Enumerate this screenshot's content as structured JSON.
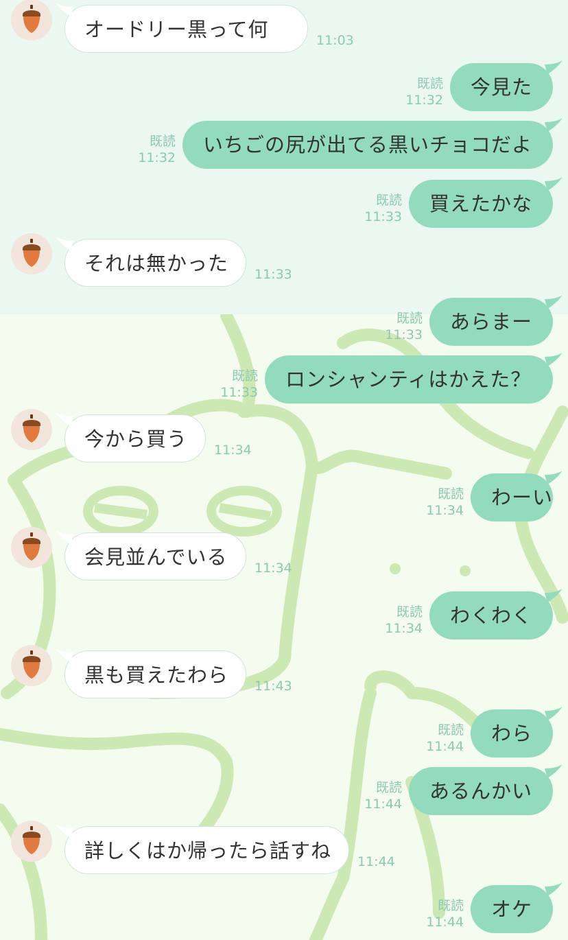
{
  "messages": [
    {
      "side": "in",
      "text": "オードリー黒って何",
      "time": "11:03"
    },
    {
      "side": "out",
      "text": "今見た",
      "time": "11:32",
      "read": "既読"
    },
    {
      "side": "out",
      "text": "いちごの尻が出てる黒いチョコだよ",
      "time": "11:32",
      "read": "既読"
    },
    {
      "side": "out",
      "text": "買えたかな",
      "time": "11:33",
      "read": "既読"
    },
    {
      "side": "in",
      "text": "それは無かった",
      "time": "11:33"
    },
    {
      "side": "out",
      "text": "あらまー",
      "time": "11:33",
      "read": "既読"
    },
    {
      "side": "out",
      "text": "ロンシャンティはかえた？",
      "time": "11:33",
      "read": "既読"
    },
    {
      "side": "in",
      "text": "今から買う",
      "time": "11:34"
    },
    {
      "side": "out",
      "text": "わーい",
      "time": "11:34",
      "read": "既読"
    },
    {
      "side": "in",
      "text": "会見並んでいる",
      "time": "11:34"
    },
    {
      "side": "out",
      "text": "わくわく",
      "time": "11:34",
      "read": "既読"
    },
    {
      "side": "in",
      "text": "黒も買えたわら",
      "time": "11:43"
    },
    {
      "side": "out",
      "text": "わら",
      "time": "11:44",
      "read": "既読"
    },
    {
      "side": "out",
      "text": "あるんかい",
      "time": "11:44",
      "read": "既読"
    },
    {
      "side": "in",
      "text": "詳しくはか帰ったら話すね",
      "time": "11:44"
    },
    {
      "side": "out",
      "text": "オケ",
      "time": "11:44",
      "read": "既読"
    }
  ],
  "avatar_icon": "acorn-icon",
  "colors": {
    "outgoing_bubble": "#92dcbd",
    "incoming_bubble": "#ffffff",
    "timestamp": "#8cc9b0",
    "background_top": "#ebf7f1",
    "background_bottom": "#f4fbef"
  }
}
